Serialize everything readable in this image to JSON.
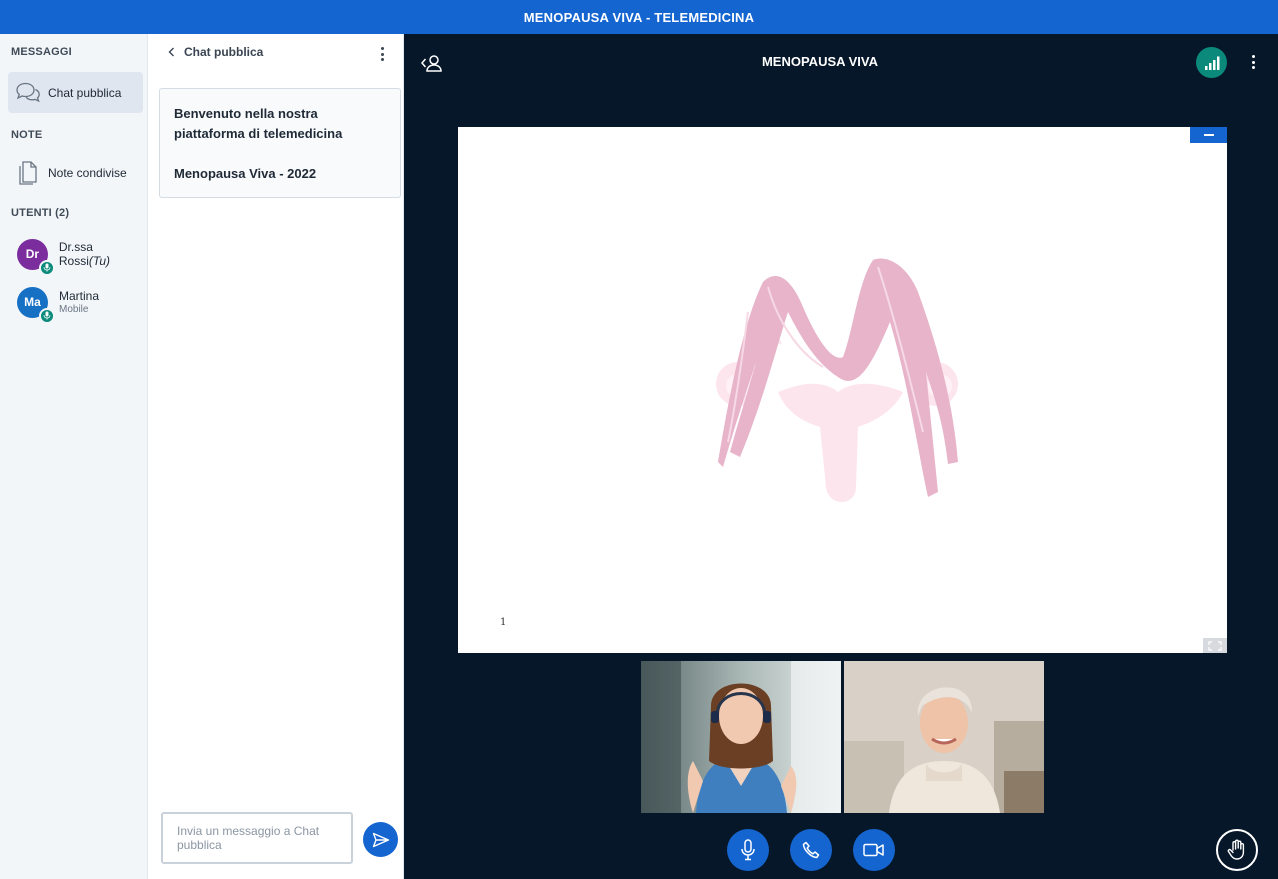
{
  "app": {
    "title": "MENOPAUSA VIVA - TELEMEDICINA"
  },
  "nav": {
    "messages_title": "MESSAGGI",
    "public_chat": "Chat pubblica",
    "notes_title": "NOTE",
    "shared_notes": "Note condivise",
    "users_title": "UTENTI (2)",
    "users": [
      {
        "initials": "Dr",
        "name": "Dr.ssa Rossi",
        "tag": "(Tu)",
        "sub": "",
        "color": "#7b2d9e"
      },
      {
        "initials": "Ma",
        "name": "Martina",
        "tag": "",
        "sub": "Mobile",
        "color": "#1670c4"
      }
    ]
  },
  "chat": {
    "title": "Chat pubblica",
    "welcome_line1": "Benvenuto nella nostra piattaforma di telemedicina",
    "welcome_line2": "Menopausa Viva - 2022",
    "input_placeholder": "Invia un messaggio a Chat pubblica"
  },
  "main": {
    "title": "MENOPAUSA VIVA",
    "slide_number": "1"
  },
  "videos": [
    {
      "name": "doctor-video"
    },
    {
      "name": "patient-video"
    }
  ],
  "colors": {
    "brand": "#1565d0",
    "dark": "#06172a",
    "success": "#0b8a7c",
    "logo_pink": "#e7b4c9"
  }
}
